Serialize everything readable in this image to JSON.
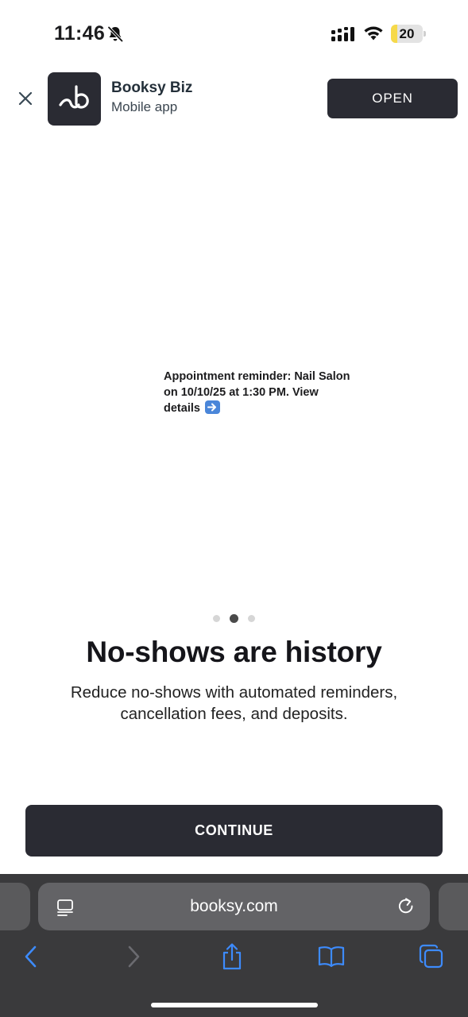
{
  "status_bar": {
    "time": "11:46",
    "battery_level": "20",
    "battery_fraction": 0.2,
    "icons": [
      "bell-slash-icon",
      "signal-icon",
      "wifi-icon",
      "battery-icon"
    ]
  },
  "app_banner": {
    "app_name": "Booksy Biz",
    "app_subtitle": "Mobile app",
    "open_label": "OPEN",
    "icons": [
      "close-icon",
      "booksy-logo-icon"
    ]
  },
  "onboarding": {
    "reminder_text": "Appointment reminder: Nail Salon on 10/10/25 at 1:30 PM. View details",
    "pager": {
      "total": 3,
      "active_index": 1
    },
    "headline": "No-shows are history",
    "subtext": "Reduce no-shows with automated reminders, cancellation fees, and deposits.",
    "continue_label": "CONTINUE"
  },
  "browser": {
    "url": "booksy.com",
    "icons": [
      "page-menu-icon",
      "reload-icon",
      "back-icon",
      "forward-icon",
      "share-icon",
      "bookmarks-icon",
      "tabs-icon"
    ]
  },
  "colors": {
    "dark_button": "#2a2b33",
    "browser_bar": "#3a3a3c",
    "address_field": "#636366",
    "toolbar_blue": "#3d8bfd",
    "battery_fill": "#f6d94a"
  }
}
